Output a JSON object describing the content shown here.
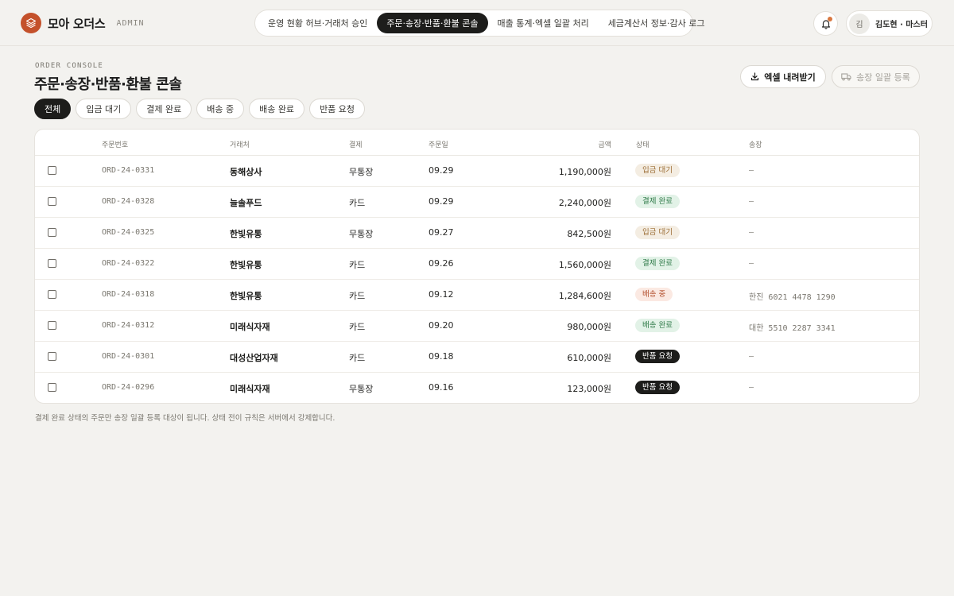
{
  "header": {
    "brand_name": "모아 오더스",
    "brand_tag": "ADMIN",
    "nav": [
      {
        "label": "운영 현황 허브·거래처 승인",
        "active": false
      },
      {
        "label": "주문·송장·반품·환불 콘솔",
        "active": true
      },
      {
        "label": "매출 통계·엑셀 일괄 처리",
        "active": false
      },
      {
        "label": "세금계산서 정보·감사 로그",
        "active": false
      }
    ],
    "notification_unread": true,
    "user_initial": "김",
    "user_name": "김도현 · 마스터"
  },
  "page": {
    "eyebrow": "ORDER CONSOLE",
    "title": "주문·송장·반품·환불 콘솔",
    "export_label": "엑셀 내려받기",
    "invoice_label": "송장 일괄 등록",
    "invoice_enabled": false
  },
  "filters": [
    {
      "label": "전체",
      "active": true
    },
    {
      "label": "입금 대기",
      "active": false
    },
    {
      "label": "결제 완료",
      "active": false
    },
    {
      "label": "배송 중",
      "active": false
    },
    {
      "label": "배송 완료",
      "active": false
    },
    {
      "label": "반품 요청",
      "active": false
    }
  ],
  "table": {
    "columns": {
      "order_no": "주문번호",
      "client": "거래처",
      "payment": "결제",
      "order_date": "주문일",
      "amount": "금액",
      "status": "상태",
      "shipment": "송장"
    },
    "rows": [
      {
        "order_no": "ORD-24-0331",
        "client": "동해상사",
        "payment": "무통장",
        "date": "09.29",
        "amount": "1,190,000원",
        "status": "입금 대기",
        "status_kind": "wait",
        "shipment": "–"
      },
      {
        "order_no": "ORD-24-0328",
        "client": "늘솔푸드",
        "payment": "카드",
        "date": "09.29",
        "amount": "2,240,000원",
        "status": "결제 완료",
        "status_kind": "paid",
        "shipment": "–"
      },
      {
        "order_no": "ORD-24-0325",
        "client": "한빛유통",
        "payment": "무통장",
        "date": "09.27",
        "amount": "842,500원",
        "status": "입금 대기",
        "status_kind": "wait",
        "shipment": "–"
      },
      {
        "order_no": "ORD-24-0322",
        "client": "한빛유통",
        "payment": "카드",
        "date": "09.26",
        "amount": "1,560,000원",
        "status": "결제 완료",
        "status_kind": "paid",
        "shipment": "–"
      },
      {
        "order_no": "ORD-24-0318",
        "client": "한빛유통",
        "payment": "카드",
        "date": "09.12",
        "amount": "1,284,600원",
        "status": "배송 중",
        "status_kind": "ship",
        "shipment": "한진 6021 4478 1290"
      },
      {
        "order_no": "ORD-24-0312",
        "client": "미래식자재",
        "payment": "카드",
        "date": "09.20",
        "amount": "980,000원",
        "status": "배송 완료",
        "status_kind": "done",
        "shipment": "대한 5510 2287 3341"
      },
      {
        "order_no": "ORD-24-0301",
        "client": "대성산업자재",
        "payment": "카드",
        "date": "09.18",
        "amount": "610,000원",
        "status": "반품 요청",
        "status_kind": "return",
        "shipment": "–"
      },
      {
        "order_no": "ORD-24-0296",
        "client": "미래식자재",
        "payment": "무통장",
        "date": "09.16",
        "amount": "123,000원",
        "status": "반품 요청",
        "status_kind": "return",
        "shipment": "–"
      }
    ]
  },
  "footnote": "결제 완료 상태의 주문만 송장 일괄 등록 대상이 됩니다. 상태 전이 규칙은 서버에서 강제합니다.",
  "colors": {
    "background": "#f3f2ef",
    "brand": "#c4512b",
    "active_dark": "#1d1d1b",
    "badge_wait": "#9c6e35",
    "badge_paid": "#2f7a48",
    "badge_shipping": "#b3502e"
  },
  "icons": {
    "logo": "layers-icon",
    "bell": "bell-icon",
    "export": "download-icon",
    "invoice": "truck-icon"
  }
}
